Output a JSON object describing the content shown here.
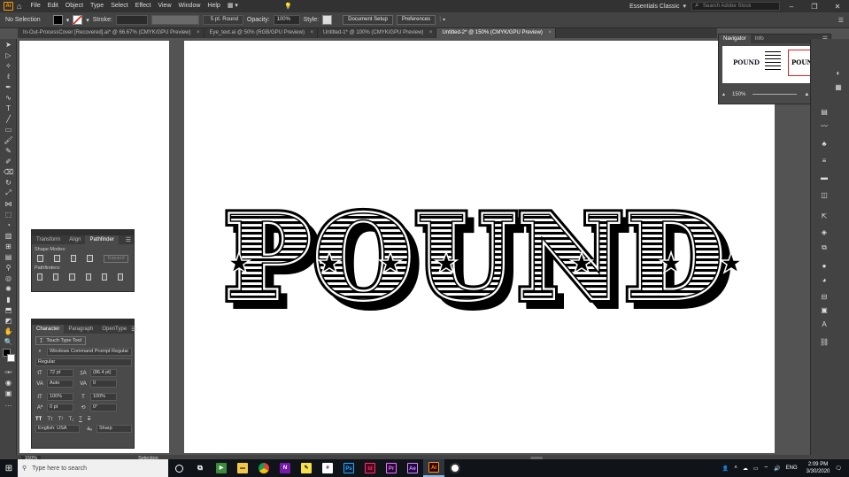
{
  "app": {
    "logo": "Ai"
  },
  "menu": [
    "File",
    "Edit",
    "Object",
    "Type",
    "Select",
    "Effect",
    "View",
    "Window",
    "Help"
  ],
  "workspace": "Essentials Classic",
  "stock_search_placeholder": "Search Adobe Stock",
  "controlbar": {
    "selection": "No Selection",
    "stroke_label": "Stroke:",
    "brush": "5 pt. Round",
    "opacity_label": "Opacity:",
    "opacity_value": "100%",
    "style_label": "Style:",
    "doc_setup": "Document Setup",
    "preferences": "Preferences"
  },
  "tabs": [
    {
      "label": "In-Out-ProcessCover [Recovered].ai* @ 66.67% (CMYK/GPU Preview)",
      "active": false
    },
    {
      "label": "Eye_text.ai @ 50% (RGB/GPU Preview)",
      "active": false
    },
    {
      "label": "Untitled-1* @ 100% (CMYK/GPU Preview)",
      "active": false
    },
    {
      "label": "Untitled-2* @ 150% (CMYK/GPU Preview)",
      "active": true
    }
  ],
  "artwork": {
    "text": "POUND",
    "accent": "#000000"
  },
  "navigator": {
    "tabs": [
      "Navigator",
      "Info"
    ],
    "zoom": "150%",
    "preview_text": "POUND"
  },
  "pathfinder": {
    "tabs": [
      "Transform",
      "Align",
      "Pathfinder"
    ],
    "shape_modes": "Shape Modes:",
    "pathfinders": "Pathfinders:",
    "expand": "Expand"
  },
  "character": {
    "tabs": [
      "Character",
      "Paragraph",
      "OpenType"
    ],
    "touch_type": "Touch Type Tool",
    "font_family": "Windows Command Prompt Regular",
    "font_style": "Regular",
    "font_size": "72 pt",
    "leading": "(86.4 pt)",
    "kerning": "Auto",
    "tracking": "0",
    "vscale": "100%",
    "hscale": "100%",
    "baseline": "0 pt",
    "rotation": "0°",
    "language": "English: USA",
    "aa": "Sharp"
  },
  "status": {
    "zoom": "150%",
    "tool": "Selection"
  },
  "taskbar": {
    "search_placeholder": "Type here to search",
    "lang": "ENG",
    "time": "2:09 PM",
    "date": "3/30/2020"
  }
}
